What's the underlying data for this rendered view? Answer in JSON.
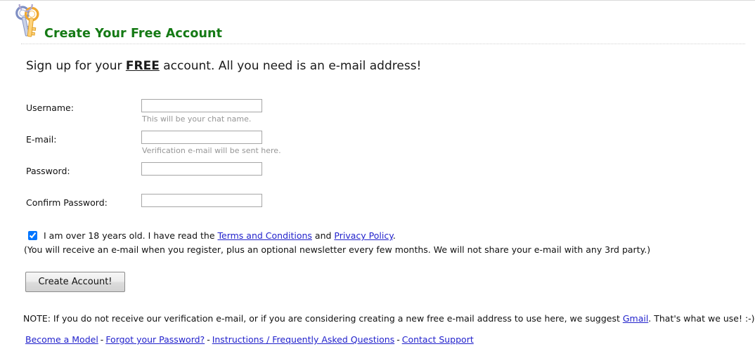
{
  "header": {
    "title": "Create Your Free Account",
    "icon": "keys-icon",
    "title_color": "#157a15"
  },
  "intro": {
    "before": "Sign up for your ",
    "emphasis": "FREE",
    "after": " account.  All you need is an e-mail address!"
  },
  "form": {
    "fields": [
      {
        "label": "Username:",
        "value": "",
        "placeholder": "",
        "hint": "This will be your chat name.",
        "type": "text",
        "name": "username"
      },
      {
        "label": "E-mail:",
        "value": "",
        "placeholder": "",
        "hint": "Verification e-mail will be sent here.",
        "type": "text",
        "name": "email"
      },
      {
        "label": "Password:",
        "value": "",
        "placeholder": "",
        "hint": "",
        "type": "password",
        "name": "password"
      },
      {
        "label": "Confirm Password:",
        "value": "",
        "placeholder": "",
        "hint": "",
        "type": "password",
        "name": "confirm-password"
      }
    ]
  },
  "consent": {
    "checked": true,
    "text_before_terms": "I am over 18 years old. I have read the ",
    "terms_link": "Terms and Conditions",
    "text_between": " and ",
    "privacy_link": "Privacy Policy",
    "text_after": ".",
    "disclaimer": "(You will receive an e-mail when you register, plus an optional newsletter every few months. We will not share your e-mail with any 3rd party.)"
  },
  "submit": {
    "label": "Create Account!"
  },
  "note": {
    "before": "NOTE: If you do not receive our verification e-mail, or if you are considering creating a new free e-mail address to use here, we suggest ",
    "link": "Gmail",
    "after": ".  That's what we use! :-)"
  },
  "footer": {
    "separator": "-",
    "links": [
      {
        "label": "Become a Model"
      },
      {
        "label": "Forgot your Password?"
      },
      {
        "label": "Instructions / Frequently Asked Questions"
      },
      {
        "label": "Contact Support"
      }
    ]
  }
}
